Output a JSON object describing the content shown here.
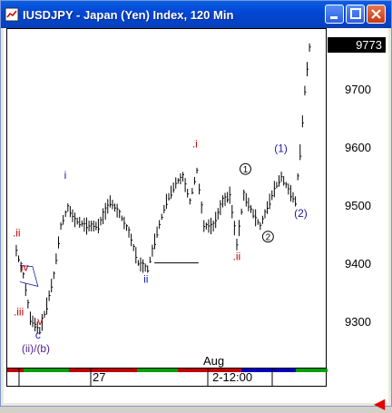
{
  "window": {
    "title": "IUSDJPY - Japan (Yen) Index, 120 Min",
    "minimize_label": "_",
    "maximize_label": "□",
    "close_label": "×"
  },
  "colors": {
    "titlebar": "#0347d6",
    "bars": "#000000",
    "wave_red": "#c00000",
    "wave_blue": "#1a1aa0",
    "wave_purple": "#4b1f8a",
    "scroll_segments": [
      "#c00000",
      "#00a000",
      "#c00000",
      "#0000c0",
      "#00a000"
    ]
  },
  "price_axis": {
    "current_price": "9773",
    "ticks": [
      "9700",
      "9600",
      "9500",
      "9400",
      "9300"
    ]
  },
  "time_axis": {
    "labels": [
      "27",
      "2-12:00"
    ],
    "month_label": "Aug"
  },
  "wave_labels": {
    "ii_red_start": ".ii",
    "iv_red": "iv",
    "iii_red": ".iii",
    "v_red": ".v",
    "c_blue": "c",
    "ii_b_purple": "(ii)/(b)",
    "i_blue": "i",
    "ii_blue": "ii",
    "i_red": ".i",
    "ii_red": ".ii",
    "one_circled": "1",
    "two_circled": "2",
    "one_paren": "(1)",
    "two_paren": "(2)"
  },
  "chart_data": {
    "type": "ohlc",
    "title": "IUSDJPY - Japan (Yen) Index, 120 Min",
    "y_range": [
      9250,
      9800
    ],
    "x_ticks": [
      "27",
      "Aug",
      "2-12:00"
    ],
    "approx_path": [
      {
        "i": 0,
        "v": 9440
      },
      {
        "i": 3,
        "v": 9400
      },
      {
        "i": 6,
        "v": 9330
      },
      {
        "i": 10,
        "v": 9310
      },
      {
        "i": 13,
        "v": 9350
      },
      {
        "i": 16,
        "v": 9400
      },
      {
        "i": 19,
        "v": 9480
      },
      {
        "i": 22,
        "v": 9510
      },
      {
        "i": 25,
        "v": 9490
      },
      {
        "i": 30,
        "v": 9480
      },
      {
        "i": 35,
        "v": 9480
      },
      {
        "i": 40,
        "v": 9520
      },
      {
        "i": 44,
        "v": 9500
      },
      {
        "i": 48,
        "v": 9470
      },
      {
        "i": 52,
        "v": 9420
      },
      {
        "i": 56,
        "v": 9410
      },
      {
        "i": 60,
        "v": 9470
      },
      {
        "i": 64,
        "v": 9520
      },
      {
        "i": 68,
        "v": 9550
      },
      {
        "i": 71,
        "v": 9560
      },
      {
        "i": 74,
        "v": 9520
      },
      {
        "i": 77,
        "v": 9570
      },
      {
        "i": 80,
        "v": 9480
      },
      {
        "i": 84,
        "v": 9480
      },
      {
        "i": 88,
        "v": 9520
      },
      {
        "i": 91,
        "v": 9530
      },
      {
        "i": 94,
        "v": 9450
      },
      {
        "i": 97,
        "v": 9530
      },
      {
        "i": 101,
        "v": 9500
      },
      {
        "i": 104,
        "v": 9480
      },
      {
        "i": 107,
        "v": 9510
      },
      {
        "i": 110,
        "v": 9540
      },
      {
        "i": 113,
        "v": 9560
      },
      {
        "i": 116,
        "v": 9540
      },
      {
        "i": 119,
        "v": 9520
      },
      {
        "i": 121,
        "v": 9600
      },
      {
        "i": 123,
        "v": 9700
      },
      {
        "i": 125,
        "v": 9770
      }
    ]
  }
}
